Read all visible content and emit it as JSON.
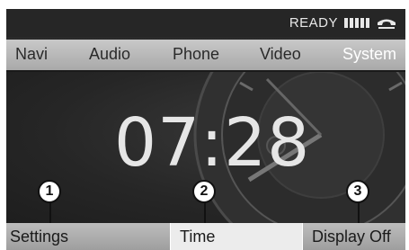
{
  "status": {
    "ready_label": "READY"
  },
  "menu": {
    "items": [
      {
        "label": "Navi"
      },
      {
        "label": "Audio"
      },
      {
        "label": "Phone"
      },
      {
        "label": "Video"
      },
      {
        "label": "System"
      }
    ],
    "active": "System"
  },
  "main": {
    "time": "07:28"
  },
  "softkeys": {
    "settings": "Settings",
    "time": "Time",
    "display_off": "Display Off"
  },
  "callouts": [
    "1",
    "2",
    "3"
  ],
  "colors": {
    "active_menu_text": "#ffffff",
    "menu_bg": "#b5b5b5",
    "screen_bg": "#262626"
  },
  "icons": {
    "signal": "signal-strength-icon",
    "phone": "phone-handset-icon"
  }
}
